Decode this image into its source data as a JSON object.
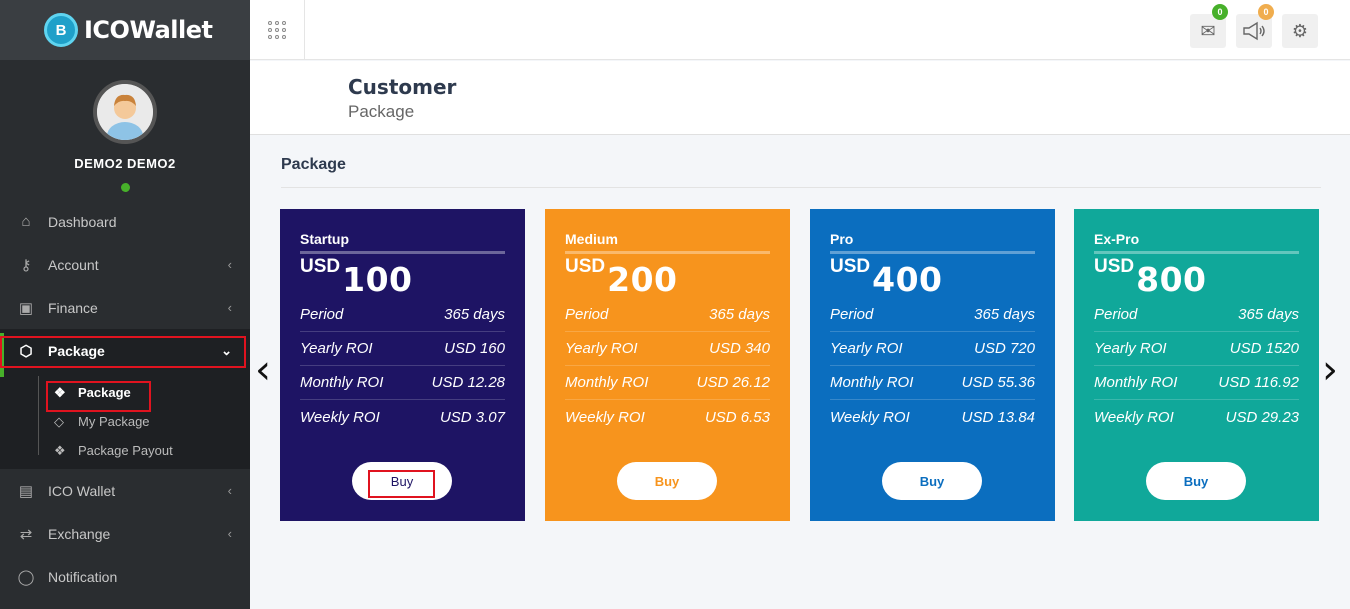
{
  "brand": {
    "logo_glyph": "B",
    "name": "ICOWallet"
  },
  "profile": {
    "name": "DEMO2 DEMO2",
    "status_color": "#47b02a"
  },
  "sidebar": {
    "items": [
      {
        "label": "Dashboard",
        "icon": "home-icon"
      },
      {
        "label": "Account",
        "icon": "key-icon"
      },
      {
        "label": "Finance",
        "icon": "money-icon"
      },
      {
        "label": "Package",
        "icon": "cube-icon"
      },
      {
        "label": "ICO Wallet",
        "icon": "id-card-icon"
      },
      {
        "label": "Exchange",
        "icon": "exchange-icon"
      },
      {
        "label": "Notification",
        "icon": "chat-icon"
      }
    ],
    "submenu": [
      {
        "label": "Package",
        "icon": "cubes-icon"
      },
      {
        "label": "My Package",
        "icon": "diamond-icon"
      },
      {
        "label": "Package Payout",
        "icon": "cubes-icon"
      }
    ]
  },
  "topbar": {
    "mail_badge": "0",
    "mail_badge_color": "#47b02a",
    "announce_badge": "0",
    "announce_badge_color": "#f0ad4e"
  },
  "header": {
    "title": "Customer",
    "subtitle": "Package"
  },
  "content": {
    "title": "Package"
  },
  "cards": [
    {
      "name": "Startup",
      "currency": "USD",
      "amount": "100",
      "color": "#1e1464",
      "period_label": "Period",
      "period": "365 days",
      "yearly_label": "Yearly ROI",
      "yearly": "USD 160",
      "monthly_label": "Monthly ROI",
      "monthly": "USD 12.28",
      "weekly_label": "Weekly ROI",
      "weekly": "USD 3.07",
      "buy": "Buy"
    },
    {
      "name": "Medium",
      "currency": "USD",
      "amount": "200",
      "color": "#f7941d",
      "period_label": "Period",
      "period": "365 days",
      "yearly_label": "Yearly ROI",
      "yearly": "USD 340",
      "monthly_label": "Monthly ROI",
      "monthly": "USD 26.12",
      "weekly_label": "Weekly ROI",
      "weekly": "USD 6.53",
      "buy": "Buy"
    },
    {
      "name": "Pro",
      "currency": "USD",
      "amount": "400",
      "color": "#0b6ebf",
      "period_label": "Period",
      "period": "365 days",
      "yearly_label": "Yearly ROI",
      "yearly": "USD 720",
      "monthly_label": "Monthly ROI",
      "monthly": "USD 55.36",
      "weekly_label": "Weekly ROI",
      "weekly": "USD 13.84",
      "buy": "Buy"
    },
    {
      "name": "Ex-Pro",
      "currency": "USD",
      "amount": "800",
      "color": "#10a89a",
      "period_label": "Period",
      "period": "365 days",
      "yearly_label": "Yearly ROI",
      "yearly": "USD 1520",
      "monthly_label": "Monthly ROI",
      "monthly": "USD 116.92",
      "weekly_label": "Weekly ROI",
      "weekly": "USD 29.23",
      "buy": "Buy"
    }
  ]
}
